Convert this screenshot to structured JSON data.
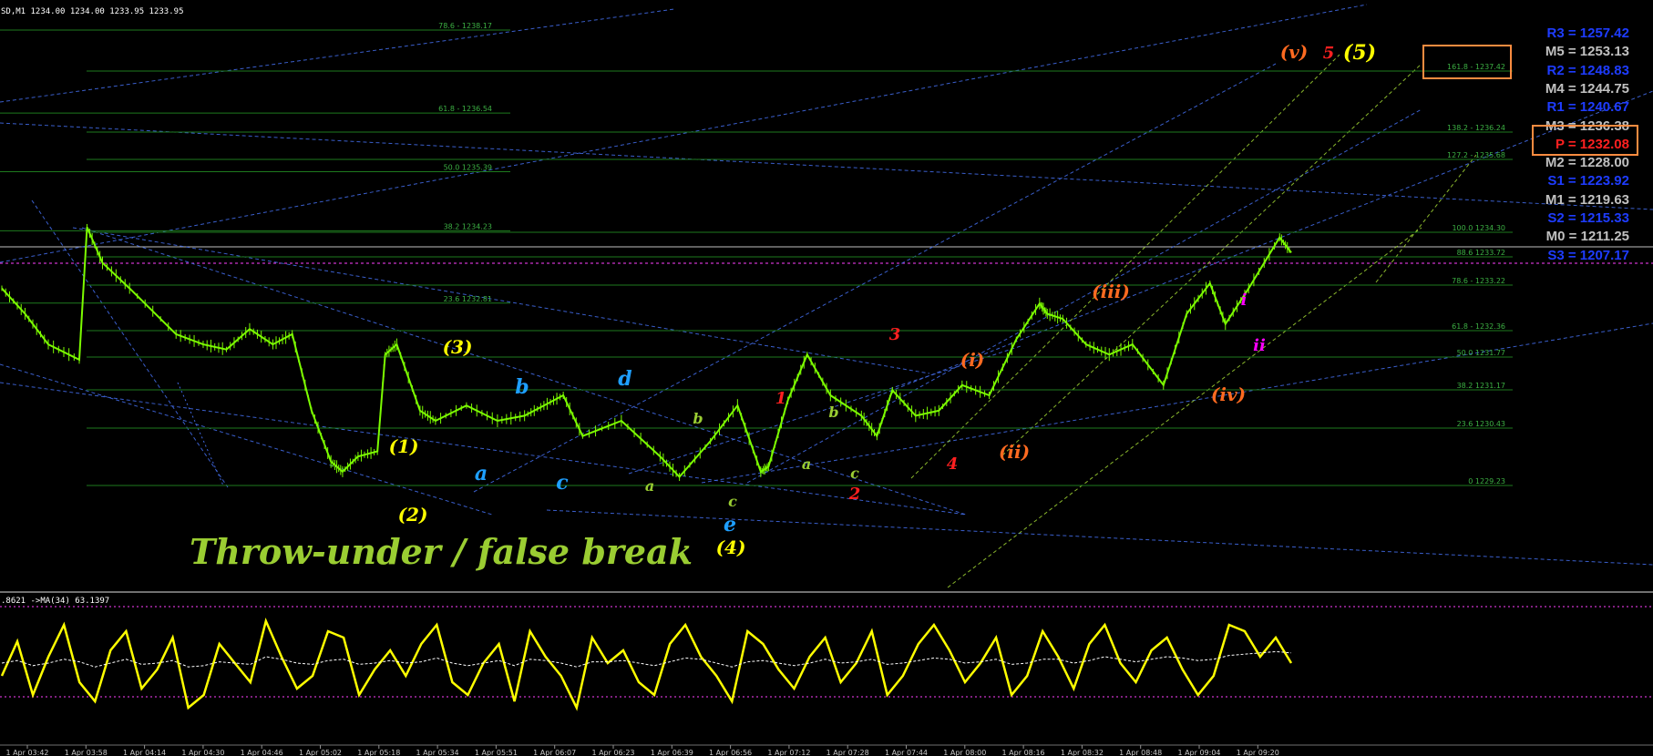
{
  "header": {
    "symbol_info": "SD,M1  1234.00 1234.00 1233.95 1233.95",
    "indicator_info": ".8621  ->MA(34) 63.1397"
  },
  "colors": {
    "background": "#000000",
    "candle": "#7cfc00",
    "fib": "#1e7a1e",
    "fib_text": "#3cb043",
    "trend_blue": "#4169e1",
    "trend_green": "#9acd32",
    "oscillator": "#ffff00",
    "osc_ma": "#ffffff",
    "pivot_r": "#1e3cff",
    "pivot_m": "#c0c0c0",
    "pivot_p": "#ff2020",
    "box": "#ff8c40"
  },
  "pivots": [
    {
      "label": "R3 = 1257.42",
      "kind": "r",
      "value": 1257.42
    },
    {
      "label": "M5 = 1253.13",
      "kind": "m",
      "value": 1253.13
    },
    {
      "label": "R2 = 1248.83",
      "kind": "r",
      "value": 1248.83
    },
    {
      "label": "M4 = 1244.75",
      "kind": "m",
      "value": 1244.75
    },
    {
      "label": "R1 = 1240.67",
      "kind": "r",
      "value": 1240.67
    },
    {
      "label": "M3 = 1236.38",
      "kind": "m",
      "value": 1236.38
    },
    {
      "label": "P  = 1232.08",
      "kind": "p",
      "value": 1232.08
    },
    {
      "label": "M2 = 1228.00",
      "kind": "m",
      "value": 1228.0
    },
    {
      "label": "S1 = 1223.92",
      "kind": "r",
      "value": 1223.92
    },
    {
      "label": "M1 = 1219.63",
      "kind": "m",
      "value": 1219.63
    },
    {
      "label": "S2 = 1215.33",
      "kind": "r",
      "value": 1215.33
    },
    {
      "label": "M0 = 1211.25",
      "kind": "m",
      "value": 1211.25
    },
    {
      "label": "S3 = 1207.17",
      "kind": "r",
      "value": 1207.17
    }
  ],
  "fib_left": [
    {
      "label": "78.6 - 1238.17",
      "price": 1238.17
    },
    {
      "label": "61.8 - 1236.54",
      "price": 1236.54
    },
    {
      "label": "50.0 1235.39",
      "price": 1235.39
    },
    {
      "label": "38.2 1234.23",
      "price": 1234.23
    },
    {
      "label": "23.6 1232.81",
      "price": 1232.81
    }
  ],
  "fib_right": [
    {
      "label": "161.8 - 1237.42",
      "price": 1237.42
    },
    {
      "label": "138.2 - 1236.24",
      "price": 1236.24
    },
    {
      "label": "127.2 - 1235.68",
      "price": 1235.68
    },
    {
      "label": "100.0 1234.30",
      "price": 1234.3
    },
    {
      "label": "88.6 1233.72",
      "price": 1233.72
    },
    {
      "label": "78.6 - 1233.22",
      "price": 1233.22
    },
    {
      "label": "61.8 - 1232.36",
      "price": 1232.36
    },
    {
      "label": "50.0 1231.77",
      "price": 1231.77
    },
    {
      "label": "38.2 1231.17",
      "price": 1231.17
    },
    {
      "label": "23.6 1230.43",
      "price": 1230.43
    },
    {
      "label": "0 1229.23",
      "price": 1229.23
    }
  ],
  "wave_labels": [
    {
      "text": "(1)",
      "color": "#ffff00",
      "size": 20
    },
    {
      "text": "(2)",
      "color": "#ffff00",
      "size": 20
    },
    {
      "text": "(3)",
      "color": "#ffff00",
      "size": 20
    },
    {
      "text": "(4)",
      "color": "#ffff00",
      "size": 20
    },
    {
      "text": "(5)",
      "color": "#ffff00",
      "size": 22
    },
    {
      "text": "a",
      "color": "#1e9fff",
      "size": 22
    },
    {
      "text": "b",
      "color": "#1e9fff",
      "size": 22
    },
    {
      "text": "c",
      "color": "#1e9fff",
      "size": 22
    },
    {
      "text": "d",
      "color": "#1e9fff",
      "size": 22
    },
    {
      "text": "e",
      "color": "#1e9fff",
      "size": 22
    },
    {
      "text": "a",
      "color": "#9acd32",
      "size": 16
    },
    {
      "text": "b",
      "color": "#9acd32",
      "size": 16
    },
    {
      "text": "c",
      "color": "#9acd32",
      "size": 16
    },
    {
      "text": "a",
      "color": "#9acd32",
      "size": 16
    },
    {
      "text": "b",
      "color": "#9acd32",
      "size": 16
    },
    {
      "text": "c",
      "color": "#9acd32",
      "size": 16
    },
    {
      "text": "1",
      "color": "#ff2020",
      "size": 18
    },
    {
      "text": "2",
      "color": "#ff2020",
      "size": 18
    },
    {
      "text": "3",
      "color": "#ff2020",
      "size": 18
    },
    {
      "text": "4",
      "color": "#ff2020",
      "size": 18
    },
    {
      "text": "5",
      "color": "#ff2020",
      "size": 18
    },
    {
      "text": "(i)",
      "color": "#ff6a20",
      "size": 20
    },
    {
      "text": "(ii)",
      "color": "#ff6a20",
      "size": 20
    },
    {
      "text": "(iii)",
      "color": "#ff6a20",
      "size": 20
    },
    {
      "text": "(iv)",
      "color": "#ff6a20",
      "size": 20
    },
    {
      "text": "(v)",
      "color": "#ff6a20",
      "size": 20
    },
    {
      "text": "i",
      "color": "#ff00ff",
      "size": 18
    },
    {
      "text": "ii",
      "color": "#ff00ff",
      "size": 18
    }
  ],
  "caption": "Throw-under / false break",
  "time_ticks": [
    "1 Apr 03:42",
    "1 Apr 03:58",
    "1 Apr 04:14",
    "1 Apr 04:30",
    "1 Apr 04:46",
    "1 Apr 05:02",
    "1 Apr 05:18",
    "1 Apr 05:34",
    "1 Apr 05:51",
    "1 Apr 06:07",
    "1 Apr 06:23",
    "1 Apr 06:39",
    "1 Apr 06:56",
    "1 Apr 07:12",
    "1 Apr 07:28",
    "1 Apr 07:44",
    "1 Apr 08:00",
    "1 Apr 08:16",
    "1 Apr 08:32",
    "1 Apr 08:48",
    "1 Apr 09:04",
    "1 Apr 09:20"
  ],
  "chart_data": [
    {
      "type": "line",
      "x_unit": "minutes",
      "ylim": [
        1229.0,
        1240.0
      ],
      "series": [
        {
          "name": "",
          "x": [
            0,
            6,
            12,
            20,
            22,
            26,
            33,
            45,
            52,
            58,
            64,
            70,
            75,
            80,
            85,
            88,
            92,
            97,
            99,
            102,
            108,
            112,
            120,
            128,
            135,
            140,
            145,
            150,
            160,
            170,
            175,
            183,
            190,
            196,
            198,
            203,
            208,
            214,
            222,
            226,
            230,
            236,
            242,
            248,
            255,
            262,
            268,
            270,
            274,
            280,
            286,
            292,
            300,
            306,
            312,
            316,
            322,
            330,
            333
          ],
          "y": [
            1233.1,
            1232.6,
            1232.0,
            1231.7,
            1234.3,
            1233.6,
            1233.1,
            1232.2,
            1232.0,
            1231.9,
            1232.3,
            1232.0,
            1232.2,
            1230.7,
            1229.7,
            1229.5,
            1229.8,
            1229.9,
            1231.8,
            1232.0,
            1230.7,
            1230.5,
            1230.8,
            1230.5,
            1230.6,
            1230.8,
            1231.0,
            1230.2,
            1230.5,
            1229.8,
            1229.4,
            1230.1,
            1230.8,
            1229.5,
            1229.6,
            1230.9,
            1231.8,
            1231.0,
            1230.6,
            1230.2,
            1231.1,
            1230.6,
            1230.7,
            1231.2,
            1231.0,
            1232.1,
            1232.8,
            1232.6,
            1232.5,
            1232.0,
            1231.8,
            1232.0,
            1231.2,
            1232.6,
            1233.2,
            1232.4,
            1233.1,
            1234.1,
            1233.8
          ]
        }
      ]
    },
    {
      "type": "line",
      "series": [
        {
          "name": "",
          "values": [
            45,
            72,
            30,
            60,
            85,
            40,
            25,
            65,
            80,
            35,
            50,
            75,
            20,
            30,
            70,
            55,
            40,
            88,
            60,
            35,
            45,
            80,
            75,
            30,
            50,
            65,
            45,
            70,
            85,
            40,
            30,
            55,
            70,
            25,
            80,
            60,
            45,
            20,
            75,
            55,
            65,
            40,
            30,
            70,
            85,
            60,
            45,
            25,
            80,
            70,
            50,
            35,
            60,
            75,
            40,
            55,
            80,
            30,
            45,
            70,
            85,
            65,
            40,
            55,
            75,
            30,
            45,
            80,
            60,
            35,
            70,
            85,
            55,
            40,
            65,
            75,
            50,
            30,
            45,
            85,
            80,
            60,
            75,
            55
          ]
        },
        {
          "name": "MA(34)",
          "values": [
            55,
            57,
            53,
            55,
            58,
            56,
            52,
            55,
            58,
            54,
            55,
            57,
            52,
            53,
            56,
            55,
            54,
            60,
            58,
            55,
            54,
            57,
            58,
            54,
            55,
            57,
            55,
            56,
            59,
            55,
            53,
            55,
            57,
            53,
            58,
            57,
            55,
            52,
            56,
            56,
            57,
            55,
            53,
            56,
            59,
            58,
            55,
            52,
            56,
            57,
            55,
            53,
            55,
            58,
            55,
            56,
            58,
            54,
            55,
            57,
            59,
            58,
            55,
            56,
            58,
            54,
            55,
            58,
            58,
            55,
            57,
            60,
            58,
            56,
            58,
            60,
            59,
            57,
            58,
            61,
            62,
            63,
            64,
            63
          ]
        }
      ]
    }
  ]
}
